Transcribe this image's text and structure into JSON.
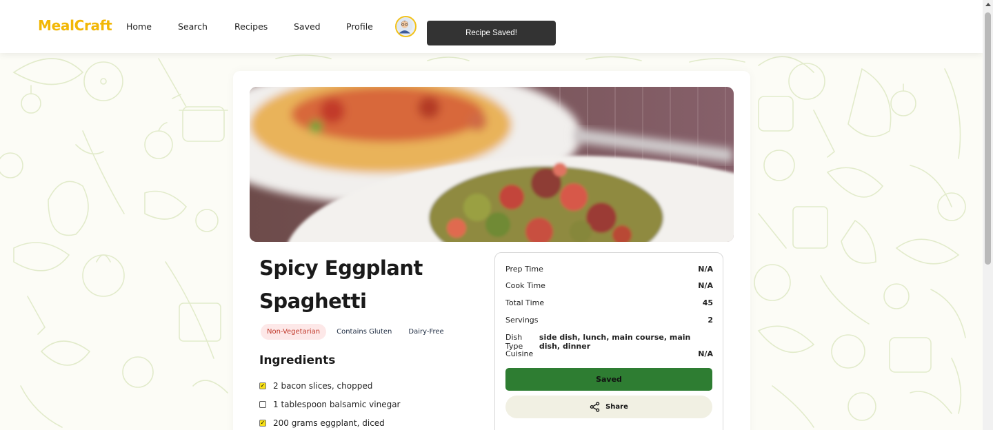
{
  "header": {
    "brand": "MealCraft",
    "nav": [
      "Home",
      "Search",
      "Recipes",
      "Saved",
      "Profile"
    ],
    "toast": "Recipe Saved!"
  },
  "recipe": {
    "title": "Spicy Eggplant Spaghetti",
    "tags": [
      "Non-Vegetarian",
      "Contains Gluten",
      "Dairy-Free"
    ],
    "ingredients_heading": "Ingredients",
    "ingredients": [
      {
        "text": "2 bacon slices, chopped",
        "checked": true
      },
      {
        "text": "1 tablespoon balsamic vinegar",
        "checked": false
      },
      {
        "text": "200 grams eggplant, diced",
        "checked": true
      }
    ]
  },
  "info": {
    "prep": {
      "label": "Prep Time",
      "value": "N/A"
    },
    "cook": {
      "label": "Cook Time",
      "value": "N/A"
    },
    "total": {
      "label": "Total Time",
      "value": "45"
    },
    "servings": {
      "label": "Servings",
      "value": "2"
    },
    "dish_type": {
      "label": "Dish Type",
      "value": "side dish, lunch, main course, main dish, dinner"
    },
    "cuisine": {
      "label": "Cuisine",
      "value": "N/A"
    },
    "saved_button": "Saved",
    "share_button": "Share"
  },
  "colors": {
    "brand": "#f2b705",
    "saved_button": "#2e7d32",
    "share_button": "#f1f0e3",
    "toast": "#333333"
  }
}
